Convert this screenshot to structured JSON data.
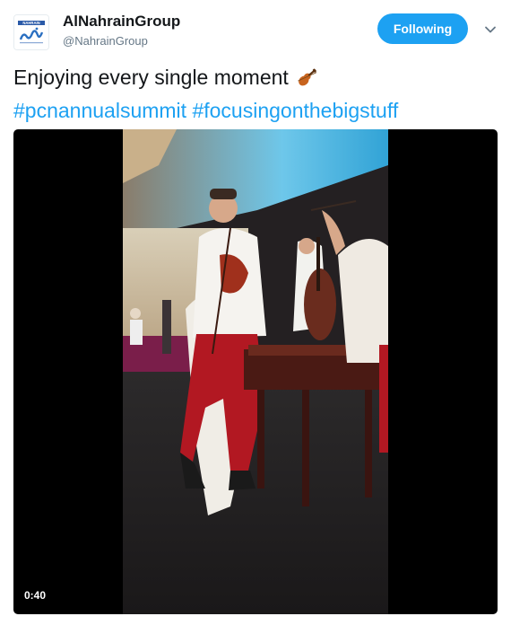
{
  "account": {
    "display_name": "AlNahrainGroup",
    "handle": "@NahrainGroup",
    "avatar_icon": "alnahrain-logo",
    "logo_text": "NAHRAIN"
  },
  "follow_button": {
    "label": "Following",
    "color": "#1da1f2"
  },
  "menu_caret_icon": "chevron-down-icon",
  "tweet": {
    "text": "Enjoying every single moment",
    "emoji_icon": "violin-icon",
    "hashtags": [
      "#pcnannualsummit",
      "#focusingonthebigstuff"
    ]
  },
  "video": {
    "duration": "0:40"
  }
}
